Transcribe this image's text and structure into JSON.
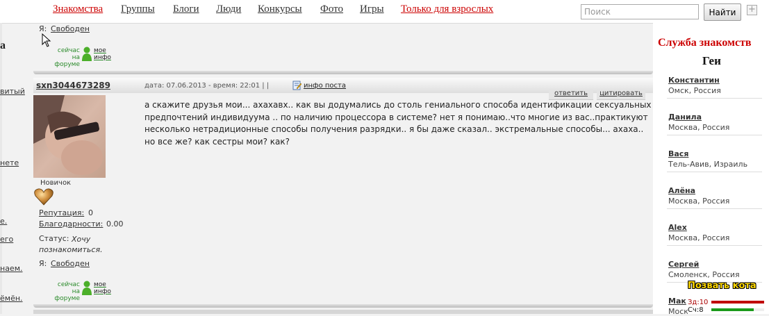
{
  "nav": {
    "items": [
      "Знакомства",
      "Группы",
      "Блоги",
      "Люди",
      "Конкурсы",
      "Фото",
      "Игры",
      "Только для взрослых"
    ],
    "search_placeholder": "Поиск",
    "search_button": "Найти"
  },
  "left_sidebar": {
    "heading_fragment": "а",
    "fragments": [
      "витый",
      "нете",
      "е.",
      "его",
      "наем.",
      "ёмён."
    ]
  },
  "prev_post": {
    "me_label": "Я:",
    "me_value": "Свободен",
    "online_left": "сейчас на форуме",
    "online_right_1": "мое",
    "online_right_2": "инфо"
  },
  "post": {
    "author": "sxn3044673289",
    "meta": "дата: 07.06.2013 - время: 22:01 | |",
    "info_link": "инфо поста",
    "reply_button": "ответить",
    "quote_button": "цитировать",
    "body": "а скажите друзья мои... ахахавх.. как вы додумались до столь гениального способа идентификации сексуальных предпочтений индивидуума .. по наличию процессора в системе? нет я понимаю..что многие из вас..практикуют несколько нетрадиционные способы получения разрядки.. я бы даже сказал.. экстремальные способы... ахаха.. но все же? как сестры мои? как?",
    "rank": "Новичок",
    "reputation_label": "Репутация:",
    "reputation_value": "0",
    "thanks_label": "Благодарности:",
    "thanks_value": "0.00",
    "status_label": "Статус:",
    "status_value": "Хочу познакомиться.",
    "me_label": "Я:",
    "me_value": "Свободен",
    "online_left": "сейчас на форуме",
    "online_right_1": "мое",
    "online_right_2": "инфо"
  },
  "right_sidebar": {
    "title": "Служба знакомств",
    "subtitle": "Геи",
    "people": [
      {
        "name": "Константин",
        "city": "Омск, Россия"
      },
      {
        "name": "Данила",
        "city": "Москва, Россия"
      },
      {
        "name": "Вася",
        "city": "Тель-Авив, Израиль"
      },
      {
        "name": "Алёна",
        "city": "Москва, Россия"
      },
      {
        "name": "Alex",
        "city": "Москва, Россия"
      },
      {
        "name": "Сергей",
        "city": "Смоленск, Россия"
      },
      {
        "name": "Мак",
        "city": "Моск"
      }
    ]
  },
  "cat_widget": {
    "title": "Позвать кота",
    "health_label": "Зд:10",
    "health_level": 1.0,
    "satiety_label": "Сч:8",
    "satiety_level": 0.8,
    "colors": {
      "health": "#c00000",
      "satiety": "#1a9a1a"
    }
  },
  "colors": {
    "nav_red": "#cc0000",
    "sidebar_title": "#cc0000",
    "online_green": "#2a8a2a"
  }
}
